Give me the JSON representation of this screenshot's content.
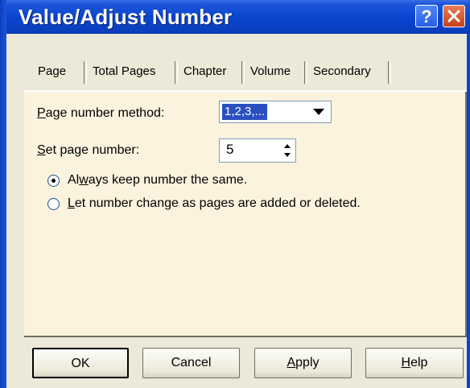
{
  "window": {
    "title": "Value/Adjust Number",
    "help_glyph": "?",
    "controls": [
      "help-icon",
      "close-icon"
    ],
    "accent": "#0a45cf"
  },
  "tabs": [
    {
      "label": "Page",
      "selected": true
    },
    {
      "label": "Total Pages",
      "selected": false
    },
    {
      "label": "Chapter",
      "selected": false
    },
    {
      "label": "Volume",
      "selected": false
    },
    {
      "label": "Secondary",
      "selected": false
    }
  ],
  "form": {
    "method_label_accel": "P",
    "method_label_rest": "age number method:",
    "method_value": "1,2,3,...",
    "set_label_accel": "S",
    "set_label_rest": "et page number:",
    "set_value": "5",
    "radios": [
      {
        "pre": "Al",
        "accel": "w",
        "post": "ays keep number the same.",
        "checked": true
      },
      {
        "pre": "",
        "accel": "L",
        "post": "et number change as pages are added or deleted.",
        "checked": false
      }
    ]
  },
  "buttons": {
    "ok": "OK",
    "cancel": "Cancel",
    "apply_accel": "A",
    "apply_rest": "pply",
    "help_accel": "H",
    "help_rest": "elp"
  }
}
